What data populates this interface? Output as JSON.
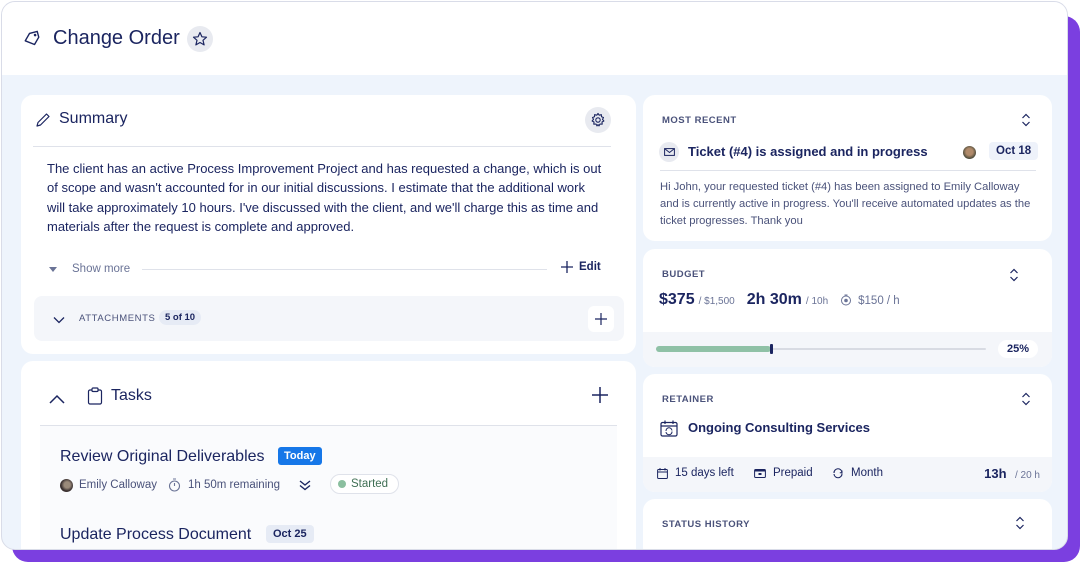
{
  "header": {
    "title": "Change Order",
    "icons": {
      "leading": "tag-icon",
      "favorite": "star-icon"
    }
  },
  "summary": {
    "title": "Summary",
    "icons": {
      "leading": "pencil-icon",
      "settings": "gear-icon"
    },
    "body": "The client has an active Process Improvement Project and has requested a change, which is out of scope and wasn't accounted for in our initial discussions. I estimate that the additional work will take approximately 10 hours. I've discussed with the client, and we'll charge this as time and materials after the request is complete and approved.",
    "show_more_label": "Show more",
    "edit_label": "Edit",
    "attachments": {
      "label": "ATTACHMENTS",
      "count": "5 of 10"
    }
  },
  "tasks": {
    "title": "Tasks",
    "items": [
      {
        "title": "Review Original Deliverables",
        "badge": "Today",
        "assignee": "Emily Calloway",
        "remaining": "1h 50m remaining",
        "status": "Started"
      },
      {
        "title": "Update Process Document",
        "badge": "Oct 25"
      }
    ]
  },
  "most_recent": {
    "label": "MOST RECENT",
    "title": "Ticket (#4) is assigned and in progress",
    "date": "Oct 18",
    "body": "Hi John, your requested ticket (#4) has been assigned to Emily Calloway and is currently active in progress. You'll receive automated updates as the ticket progresses. Thank you"
  },
  "budget": {
    "label": "BUDGET",
    "spent": "$375",
    "total": "/ $1,500",
    "time_spent": "2h 30m",
    "time_total": "/ 10h",
    "rate": "$150 / h",
    "progress_percent": 25,
    "progress_label": "25%"
  },
  "retainer": {
    "label": "RETAINER",
    "title": "Ongoing Consulting Services",
    "days_left": "15 days left",
    "billing": "Prepaid",
    "period": "Month",
    "hours_used": "13h",
    "hours_total": "/ 20 h"
  },
  "status_history": {
    "label": "STATUS HISTORY"
  },
  "colors": {
    "accent_purple": "#7b3fe0",
    "today_badge": "#1677e8",
    "status_started": "#8bbf9f",
    "progress_fill": "#8fc1a6",
    "text_primary": "#1b2560"
  }
}
